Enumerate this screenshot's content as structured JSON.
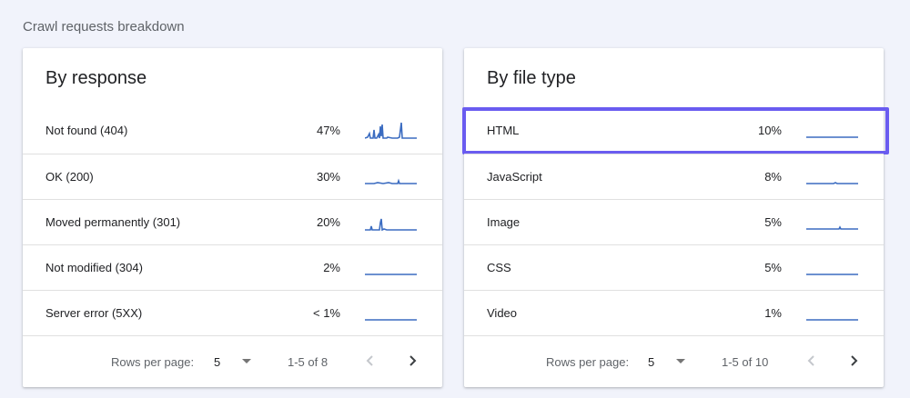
{
  "section_title": "Crawl requests breakdown",
  "accent_color": "#6a5cf0",
  "spark_color": "#3b6cc1",
  "by_response": {
    "title": "By response",
    "rows": [
      {
        "label": "Not found (404)",
        "pct": "47%"
      },
      {
        "label": "OK (200)",
        "pct": "30%"
      },
      {
        "label": "Moved permanently (301)",
        "pct": "20%"
      },
      {
        "label": "Not modified (304)",
        "pct": "2%"
      },
      {
        "label": "Server error (5XX)",
        "pct": "< 1%"
      }
    ],
    "footer": {
      "rows_per_page_label": "Rows per page:",
      "rows_per_page_value": "5",
      "range": "1-5 of 8"
    }
  },
  "by_file_type": {
    "title": "By file type",
    "rows": [
      {
        "label": "HTML",
        "pct": "10%",
        "highlighted": true
      },
      {
        "label": "JavaScript",
        "pct": "8%"
      },
      {
        "label": "Image",
        "pct": "5%"
      },
      {
        "label": "CSS",
        "pct": "5%"
      },
      {
        "label": "Video",
        "pct": "1%"
      }
    ],
    "footer": {
      "rows_per_page_label": "Rows per page:",
      "rows_per_page_value": "5",
      "range": "1-5 of 10"
    }
  },
  "icons": {
    "prev": "chevron-left-icon",
    "next": "chevron-right-icon",
    "dropdown": "caret-down-icon"
  }
}
